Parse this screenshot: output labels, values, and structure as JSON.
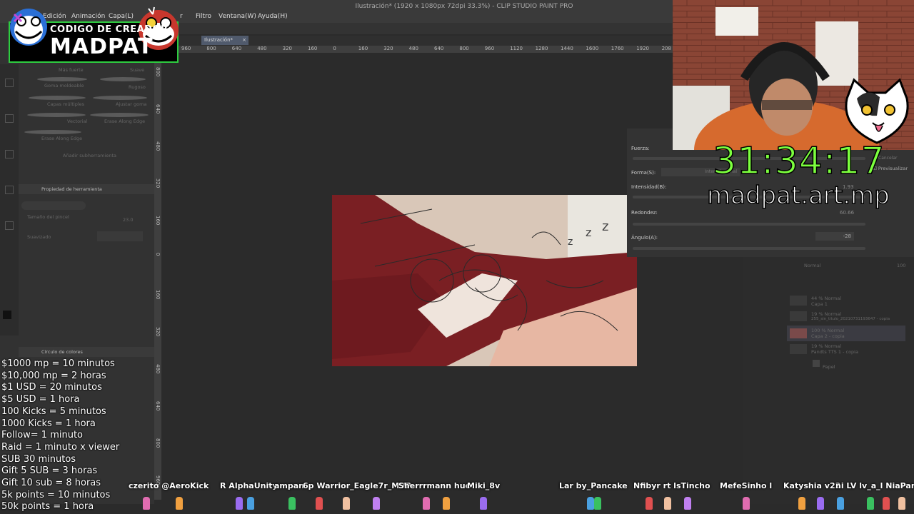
{
  "app": {
    "title": "Ilustración* (1920 x 1080px 72dpi 33.3%) - CLIP STUDIO PAINT PRO",
    "menus": [
      "Edición",
      "Animación",
      "Capa(L)",
      "r",
      "Filtro",
      "Ventana(W)",
      "Ayuda(H)"
    ],
    "tab_label": "Ilustración*"
  },
  "ruler": {
    "top_ticks": [
      "960",
      "800",
      "640",
      "480",
      "320",
      "160",
      "0",
      "160",
      "320",
      "480",
      "640",
      "800",
      "960",
      "1120",
      "1280",
      "1440",
      "1600",
      "1760",
      "1920",
      "208"
    ],
    "left_ticks": [
      "800",
      "640",
      "480",
      "320",
      "160",
      "0",
      "160",
      "320",
      "480",
      "640",
      "800",
      "960"
    ]
  },
  "brushes": {
    "items": [
      "Más fuerte",
      "Suave",
      "Goma moldeable",
      "Rugoso",
      "Capas múltiples",
      "Ajustar goma",
      "Vectorial",
      "Erase Along Edge",
      "Erase Along Edge"
    ],
    "add_tool": "Añadir subherramienta"
  },
  "panels": {
    "tool_property": "Propiedad de herramienta",
    "brush_size": "Tamaño del pincel",
    "brush_size_value": "23.0",
    "softness": "Suavizado",
    "color_circle": "Círculo de colores"
  },
  "logo": {
    "line1": "CODIGO DE CREADOR",
    "line2": "MADPAT"
  },
  "dialog": {
    "fuerza": "Fuerza:",
    "forma": "Forma(S):",
    "intensidad": "Intensidad(B):",
    "intensidad_value": "1.93",
    "redondez": "Redondez:",
    "redondez_value": "60.66",
    "angulo": "Ángulo(A):",
    "angulo_value": "-28",
    "cancel": "Cancelar",
    "preview": "Previsualizar",
    "shape_option": "Interpolacional"
  },
  "layers": {
    "items": [
      "44 % Normal",
      "Capa 1",
      "19 % Normal",
      "255_sin_titulo_20210731193647 - copia",
      "100 % Normal",
      "Capa 2 - copia",
      "19 % Normal",
      "Pandts TTS 1 - copia",
      "Papel"
    ],
    "blend_mode": "Normal",
    "opacity": "100"
  },
  "overlay": {
    "timer": "31:34:17",
    "handle": "madpat.art.mp"
  },
  "rates": [
    "$1000 mp = 10 minutos",
    "$10,000 mp = 2 horas",
    "$1 USD = 20 minutos",
    "$5 USD = 1 hora",
    "100 Kicks = 5 minutos",
    "1000 Kicks = 1 hora",
    "Follow= 1 minuto",
    "Raid = 1 minuto x viewer",
    "SUB 30 minutos",
    "Gift 5 SUB = 3 horas",
    "Gift 10 sub = 8 horas",
    "5k points = 10 minutos",
    "50k points = 1 hora"
  ],
  "viewers": [
    "czerito @AeroKick",
    "R AlphaUnity",
    "ampan",
    "6p Warrior_Eagle7r_MVP",
    "Sherrrmann hue",
    "Miki_8v",
    "Lar by_Pancake",
    "Nfibyr rt lsTincho",
    "MefeSinho l",
    "Katyshia v23",
    "ni LV lv_a_l NiaPan"
  ],
  "colors": {
    "timer": "#7cff3e",
    "logo_border": "#2ecc40",
    "canvas_bg": "#2b2b2b",
    "panel_bg": "#323232"
  }
}
